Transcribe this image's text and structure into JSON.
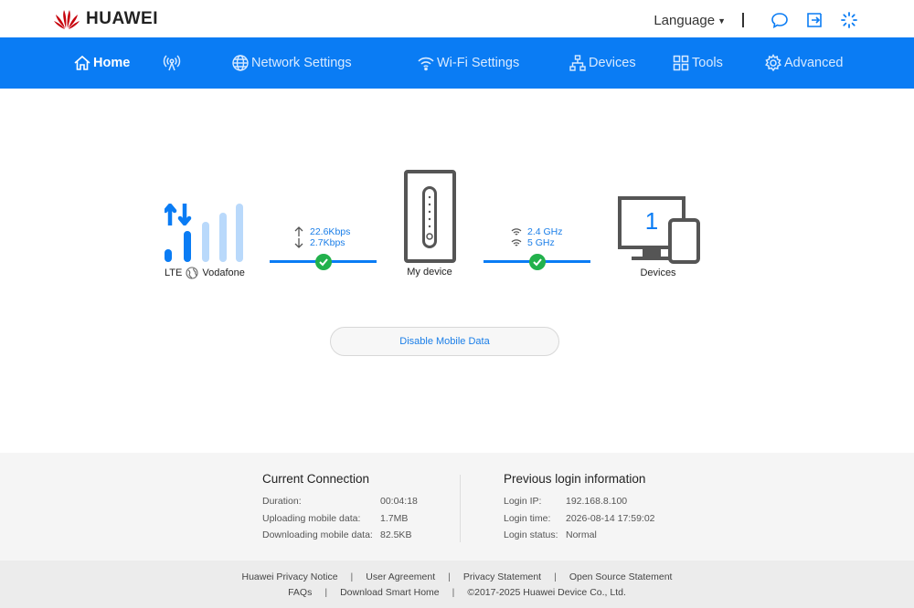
{
  "header": {
    "brand": "HUAWEI",
    "language_label": "Language",
    "brand_color": "#c7000b"
  },
  "nav": {
    "accent": "#0a7cf4",
    "items": [
      {
        "label": "Home",
        "icon": "home-icon",
        "active": true
      },
      {
        "label": "",
        "icon": "antenna-icon"
      },
      {
        "label": "Network Settings",
        "icon": "globe-icon"
      },
      {
        "label": "Wi-Fi Settings",
        "icon": "wifi-icon"
      },
      {
        "label": "Devices",
        "icon": "network-devices-icon"
      },
      {
        "label": "Tools",
        "icon": "tools-icon"
      },
      {
        "label": "Advanced",
        "icon": "gear-icon"
      }
    ]
  },
  "status": {
    "network_type": "LTE",
    "operator": "Vodafone",
    "upload_rate": "22.6Kbps",
    "download_rate": "2.7Kbps",
    "device_label": "My device",
    "wifi_band_1": "2.4 GHz",
    "wifi_band_2": "5 GHz",
    "connected_devices_count": "1",
    "devices_label": "Devices",
    "signal_bars_strong": 2,
    "signal_bars_total": 5
  },
  "actions": {
    "disable_mobile_data": "Disable Mobile Data"
  },
  "current_connection": {
    "title": "Current Connection",
    "rows": [
      {
        "label": "Duration:",
        "value": "00:04:18"
      },
      {
        "label": "Uploading mobile data:",
        "value": "1.7MB"
      },
      {
        "label": "Downloading mobile data:",
        "value": "82.5KB"
      }
    ]
  },
  "previous_login": {
    "title": "Previous login information",
    "rows": [
      {
        "label": "Login IP:",
        "value": "192.168.8.100"
      },
      {
        "label": "Login time:",
        "value": "2026-08-14 17:59:02"
      },
      {
        "label": "Login status:",
        "value": "Normal"
      }
    ]
  },
  "footer": {
    "links_row1": [
      "Huawei Privacy Notice",
      "User Agreement",
      "Privacy Statement",
      "Open Source Statement"
    ],
    "links_row2": [
      "FAQs",
      "Download Smart Home"
    ],
    "copyright": "©2017-2025 Huawei Device Co., Ltd."
  }
}
